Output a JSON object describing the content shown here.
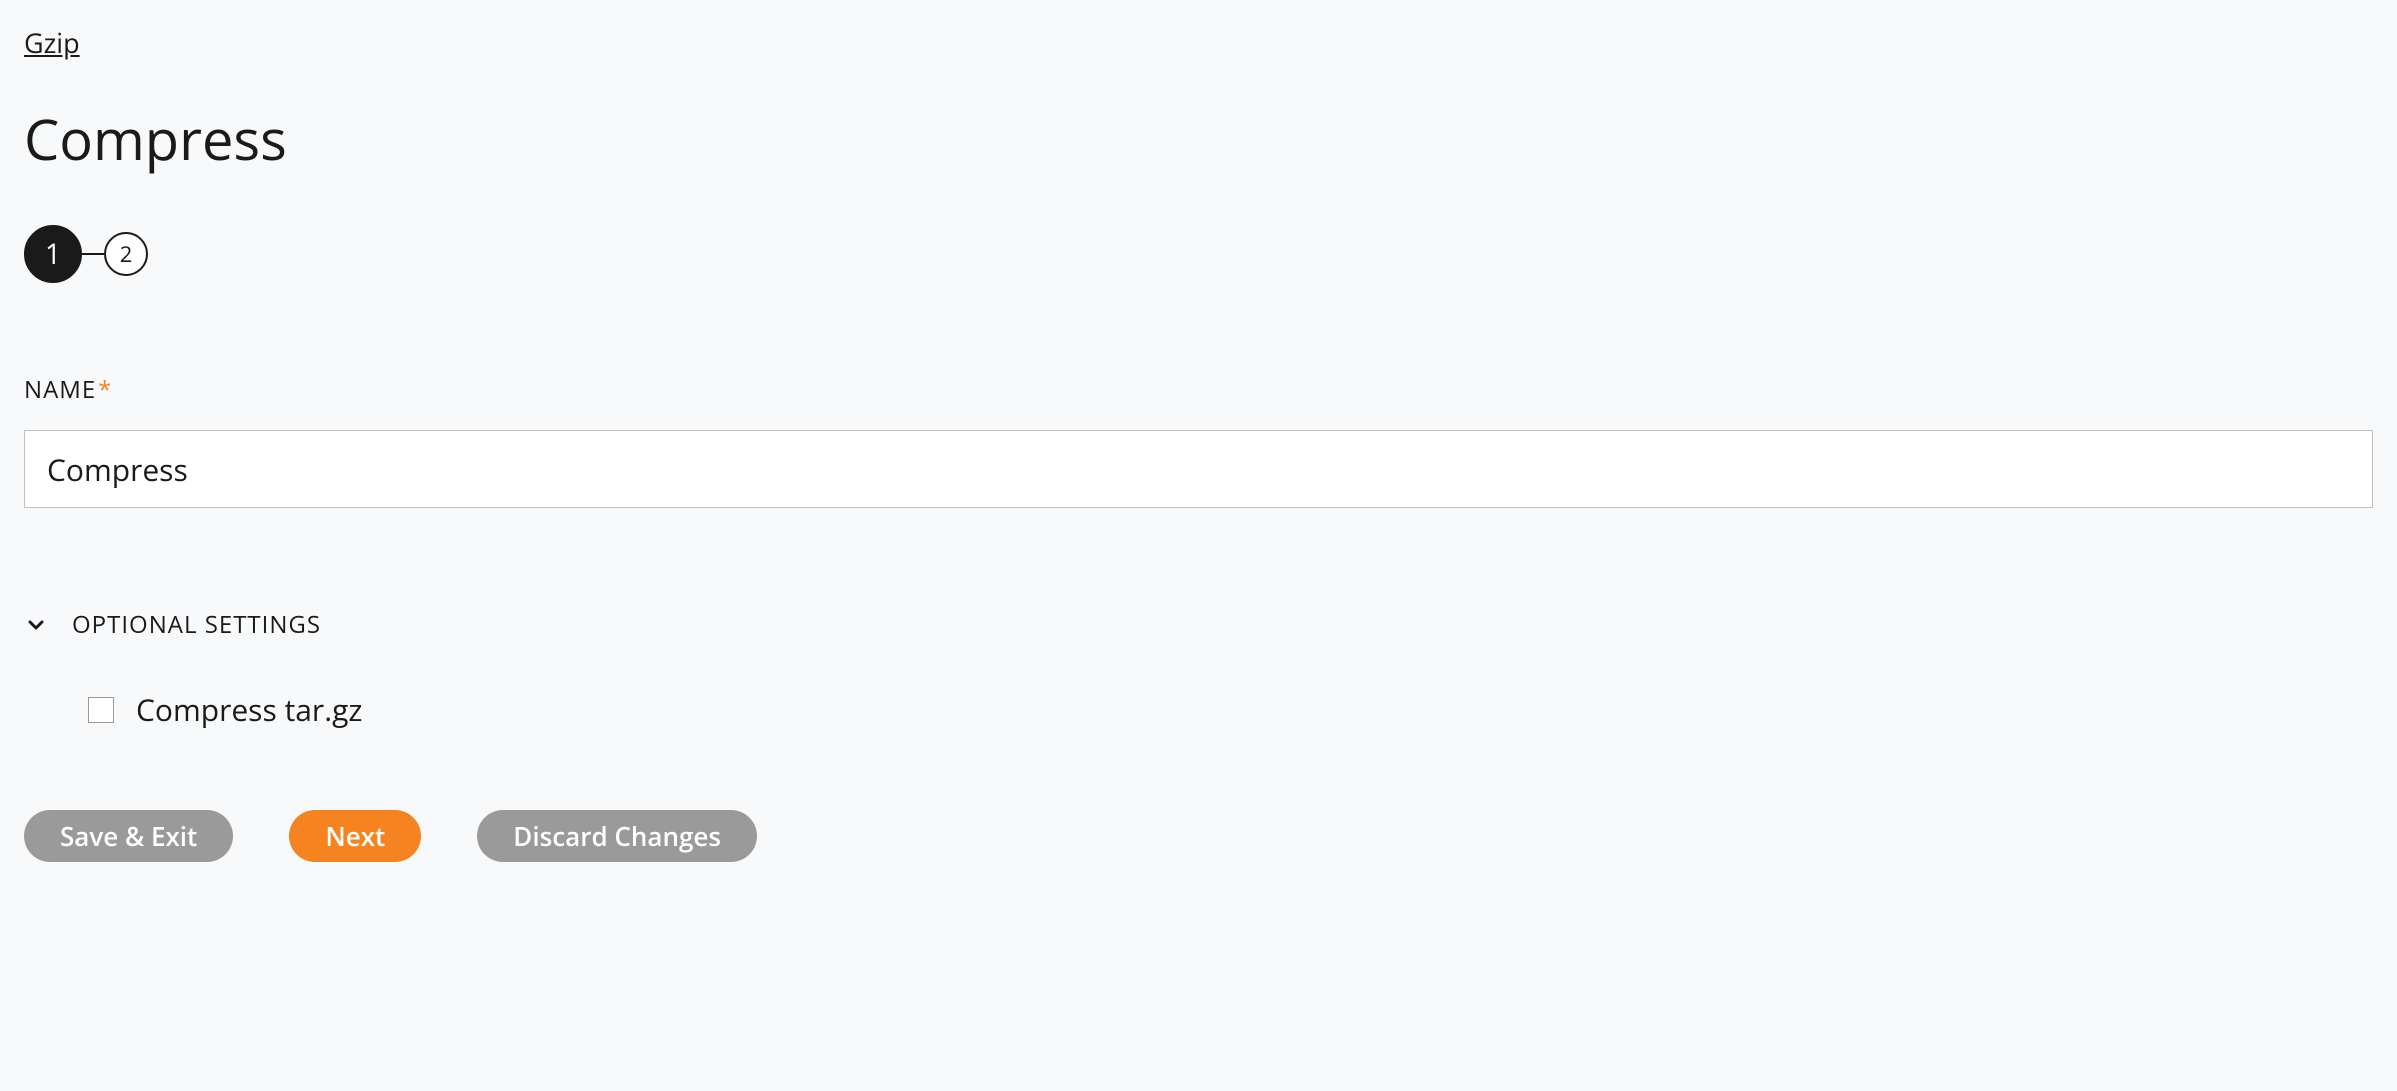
{
  "breadcrumb": "Gzip",
  "page_title": "Compress",
  "stepper": {
    "step1": "1",
    "step2": "2"
  },
  "form": {
    "name_label": "NAME",
    "name_value": "Compress"
  },
  "optional": {
    "header": "OPTIONAL SETTINGS",
    "compress_targz_label": "Compress tar.gz"
  },
  "buttons": {
    "save_exit": "Save & Exit",
    "next": "Next",
    "discard": "Discard Changes"
  }
}
